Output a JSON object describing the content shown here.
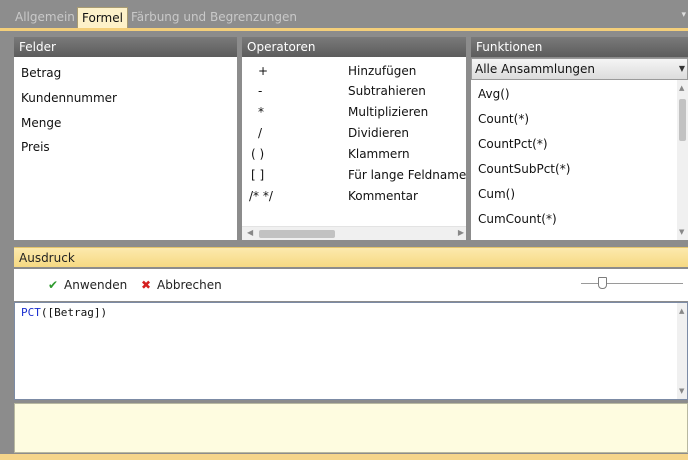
{
  "tabs": [
    {
      "label": "Allgemein"
    },
    {
      "label": "Formel"
    },
    {
      "label": "Färbung und Begrenzungen"
    }
  ],
  "felder": {
    "header": "Felder",
    "items": [
      "Betrag",
      "Kundennummer",
      "Menge",
      "Preis"
    ]
  },
  "operatoren": {
    "header": "Operatoren",
    "items": [
      {
        "symbol": "+",
        "name": "Hinzufügen"
      },
      {
        "symbol": "-",
        "name": "Subtrahieren"
      },
      {
        "symbol": "*",
        "name": "Multiplizieren"
      },
      {
        "symbol": "/",
        "name": "Dividieren"
      },
      {
        "symbol": "( )",
        "name": "Klammern"
      },
      {
        "symbol": "[ ]",
        "name": "Für lange Feldnamen"
      },
      {
        "symbol": "/* */",
        "name": "Kommentar"
      }
    ]
  },
  "funktionen": {
    "header": "Funktionen",
    "dropdown_value": "Alle Ansammlungen",
    "items": [
      "Avg()",
      "Count(*)",
      "CountPct(*)",
      "CountSubPct(*)",
      "Cum()",
      "CumCount(*)"
    ]
  },
  "ausdruck": {
    "header": "Ausdruck",
    "apply_label": "Anwenden",
    "cancel_label": "Abbrechen",
    "code_keyword": "PCT",
    "code_rest": "([Betrag])"
  },
  "colors": {
    "tab_active_bg": "#fdf1c9",
    "accent": "#f4cf7a",
    "check_green": "#2e9a2e",
    "cancel_red": "#d42020",
    "keyword_blue": "#1a2fd0"
  }
}
